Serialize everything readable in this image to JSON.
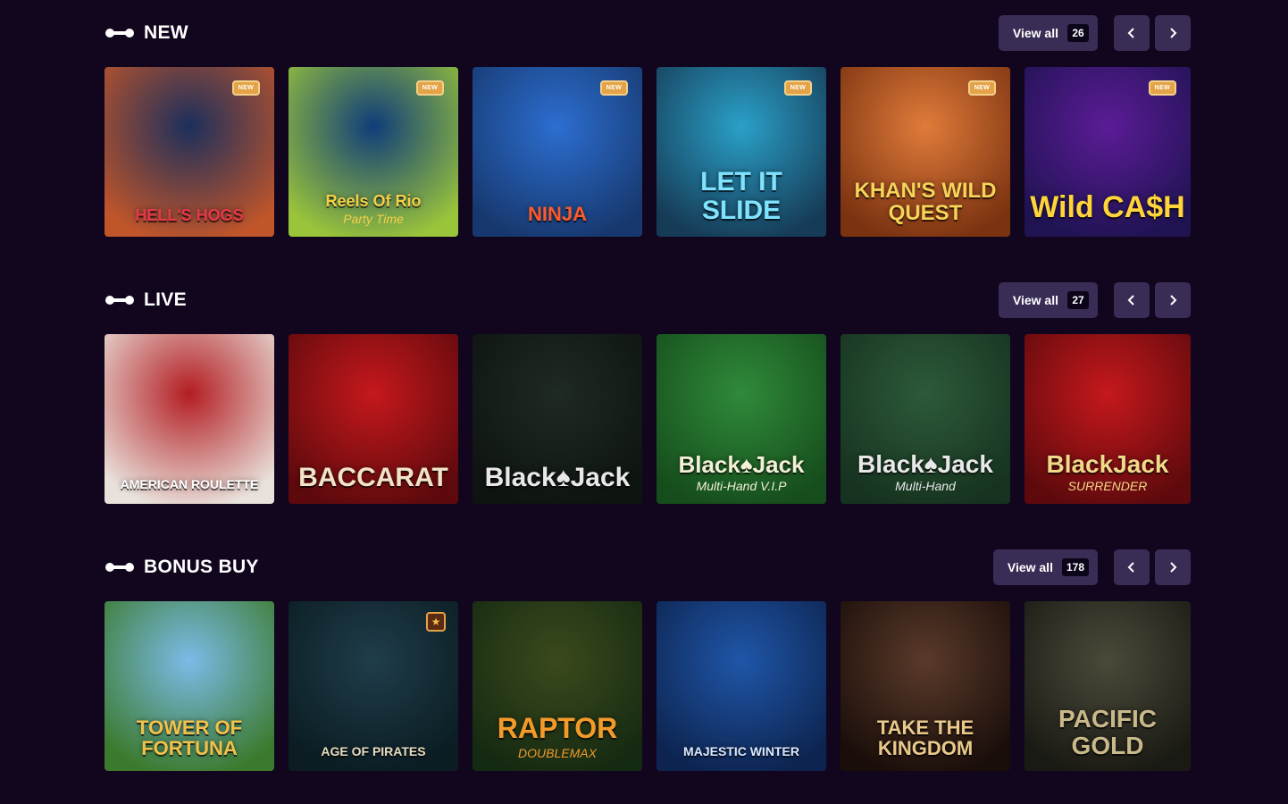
{
  "sections": [
    {
      "title": "NEW",
      "view_all_label": "View all",
      "count": "26",
      "games": [
        {
          "name": "HELL'S HOGS",
          "badge": "NEW",
          "bg": [
            "#1c2f5c",
            "#c0552a"
          ],
          "color": "#e6384a",
          "size": 18
        },
        {
          "name": "Reels Of Rio",
          "sub": "Party Time",
          "badge": "NEW",
          "bg": [
            "#0f3d7a",
            "#9ac43a"
          ],
          "color": "#f3d04a",
          "size": 18
        },
        {
          "name": "NINJA",
          "badge": "NEW",
          "bg": [
            "#2c6ed0",
            "#17386e"
          ],
          "color": "#ff5a2a",
          "size": 22
        },
        {
          "name": "LET IT SLIDE",
          "badge": "NEW",
          "bg": [
            "#2aa0c8",
            "#163b56"
          ],
          "color": "#7fe3ff",
          "size": 30
        },
        {
          "name": "KHAN'S WILD QUEST",
          "badge": "NEW",
          "bg": [
            "#e07b3a",
            "#7a3210"
          ],
          "color": "#f7d35a",
          "size": 24
        },
        {
          "name": "Wild CA$H",
          "badge": "NEW",
          "bg": [
            "#5b1c96",
            "#1f1352"
          ],
          "color": "#ffd53a",
          "size": 34
        }
      ]
    },
    {
      "title": "LIVE",
      "view_all_label": "View all",
      "count": "27",
      "games": [
        {
          "name": "AMERICAN ROULETTE",
          "bg": [
            "#b31d22",
            "#e9e2dc"
          ],
          "color": "#ffffff",
          "size": 14
        },
        {
          "name": "BACCARAT",
          "bg": [
            "#c5181c",
            "#5e0a0d"
          ],
          "color": "#f1e3c8",
          "size": 30
        },
        {
          "name": "Black♠Jack",
          "bg": [
            "#1f2a23",
            "#0e1410"
          ],
          "color": "#e8e8e8",
          "size": 30
        },
        {
          "name": "Black♠Jack",
          "sub": "Multi-Hand V.I.P",
          "bg": [
            "#2f8a3a",
            "#164d1c"
          ],
          "color": "#f3f0d6",
          "size": 26
        },
        {
          "name": "Black♠Jack",
          "sub": "Multi-Hand",
          "bg": [
            "#2d5a3a",
            "#16331f"
          ],
          "color": "#e8e8e8",
          "size": 28
        },
        {
          "name": "BlackJack",
          "sub": "SURRENDER",
          "bg": [
            "#c5181c",
            "#5e0a0d"
          ],
          "color": "#f1d98a",
          "size": 28
        }
      ]
    },
    {
      "title": "BONUS BUY",
      "view_all_label": "View all",
      "count": "178",
      "games": [
        {
          "name": "TOWER OF FORTUNA",
          "bg": [
            "#7bbbe8",
            "#3b7a2c"
          ],
          "color": "#f2c14a",
          "size": 22
        },
        {
          "name": "AGE OF PIRATES",
          "star": "★",
          "bg": [
            "#1f3d4a",
            "#0b1c22"
          ],
          "color": "#e8dcc0",
          "size": 14
        },
        {
          "name": "RAPTOR",
          "sub": "DOUBLEMAX",
          "bg": [
            "#3b4a1c",
            "#152a12"
          ],
          "color": "#f39b2a",
          "size": 32
        },
        {
          "name": "MAJESTIC WINTER",
          "bg": [
            "#1f56a8",
            "#0d2450"
          ],
          "color": "#dbe9ff",
          "size": 14
        },
        {
          "name": "TAKE THE KINGDOM",
          "bg": [
            "#5a3a2a",
            "#1a0e0a"
          ],
          "color": "#e8c98a",
          "size": 22
        },
        {
          "name": "PACIFIC GOLD",
          "bg": [
            "#4a4a3a",
            "#1a1a14"
          ],
          "color": "#c9b98a",
          "size": 28
        }
      ]
    }
  ]
}
